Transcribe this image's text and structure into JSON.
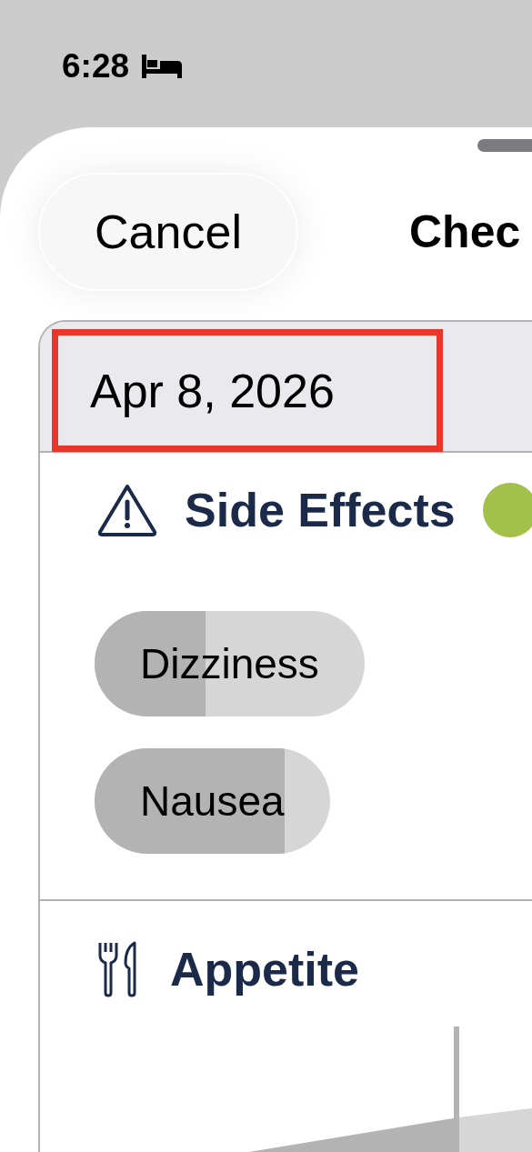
{
  "status_bar": {
    "time": "6:28"
  },
  "sheet": {
    "cancel_button": "Cancel",
    "title": "Chec"
  },
  "date_header": {
    "date": "Apr 8, 2026",
    "highlighted": true
  },
  "sections": [
    {
      "kind": "side_effects",
      "title": "Side Effects",
      "chips": [
        {
          "label": "Dizziness",
          "level": 0.41
        },
        {
          "label": "Nausea",
          "level": 0.81
        }
      ]
    },
    {
      "kind": "appetite",
      "title": "Appetite"
    }
  ]
}
